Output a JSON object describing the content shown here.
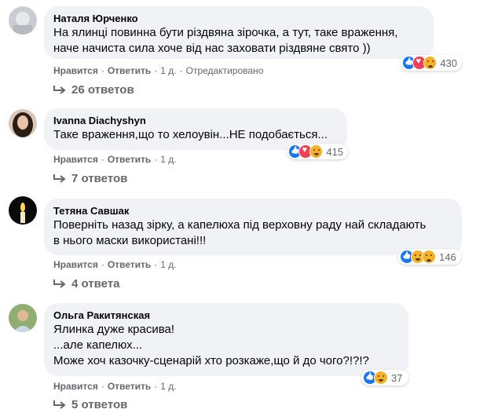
{
  "comments": [
    {
      "author": "Наталя Юрченко",
      "text": "На ялинці повинна бути різдвяна зірочка, а тут, таке враження,\nначе начиста сила хоче від нас заховати різдвяне свято ))",
      "reaction_count": "430",
      "reaction_icons": [
        "like-reaction-icon",
        "love-reaction-icon",
        "sad-reaction-icon"
      ],
      "like_label": "Нравится",
      "reply_label": "Ответить",
      "time": "1 д.",
      "edited": "Отредактировано",
      "replies_label": "26 ответов"
    },
    {
      "author": "Ivanna Diachyshyn",
      "text": "Таке враження,що то хелоувін...НЕ подобається...",
      "reaction_count": "415",
      "reaction_icons": [
        "like-reaction-icon",
        "love-reaction-icon",
        "haha-reaction-icon"
      ],
      "like_label": "Нравится",
      "reply_label": "Ответить",
      "time": "1 д.",
      "replies_label": "7 ответов"
    },
    {
      "author": "Тетяна Савшак",
      "text": "Поверніть назад зірку, а капелюха під верховну раду най складають\nв нього маски використані!!!",
      "reaction_count": "146",
      "reaction_icons": [
        "like-reaction-icon",
        "haha-reaction-icon",
        "sad-reaction-icon"
      ],
      "like_label": "Нравится",
      "reply_label": "Ответить",
      "time": "1 д.",
      "replies_label": "4 ответа"
    },
    {
      "author": "Ольга Ракитянская",
      "text": "Ялинка дуже красива!\n...але капелюх...\nМоже хоч казочку-сценарій хто розкаже,що й до чого?!?!?",
      "reaction_count": "37",
      "reaction_icons": [
        "like-reaction-icon",
        "haha-reaction-icon"
      ],
      "like_label": "Нравится",
      "reply_label": "Ответить",
      "time": "1 д.",
      "replies_label": "5 ответов"
    }
  ]
}
